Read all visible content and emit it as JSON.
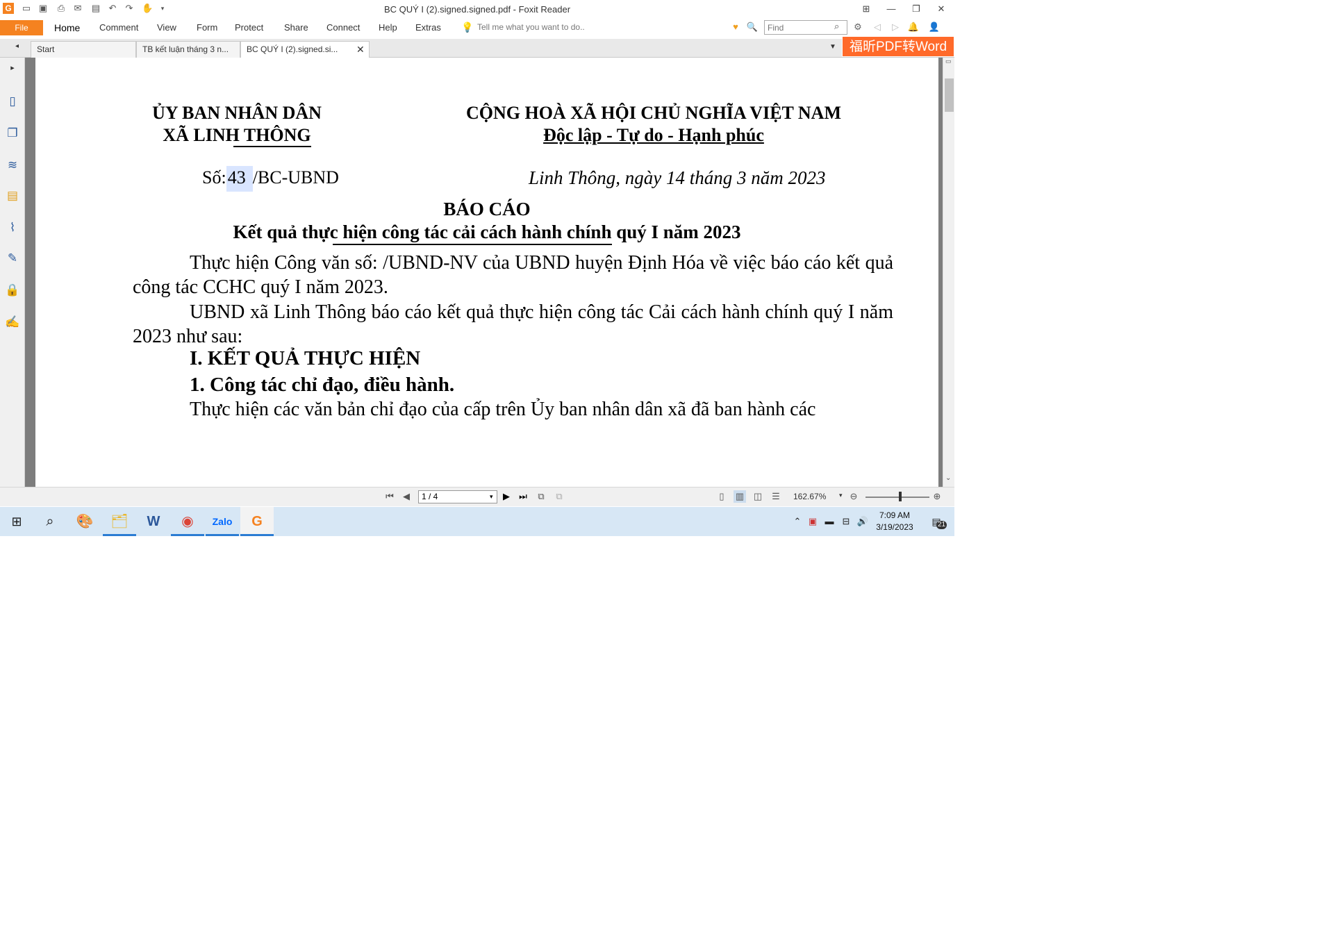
{
  "window": {
    "title": "BC QUÝ I (2).signed.signed.pdf - Foxit Reader"
  },
  "ribbon": {
    "file_label": "File",
    "menus": [
      "Home",
      "Comment",
      "View",
      "Form",
      "Protect",
      "Share",
      "Connect",
      "Help",
      "Extras"
    ],
    "tellme": "Tell me what you want to do..",
    "find_placeholder": "Find"
  },
  "tabs": [
    {
      "label": "Start"
    },
    {
      "label": "TB kết luận tháng 3 n..."
    },
    {
      "label": "BC QUÝ I (2).signed.si..."
    }
  ],
  "promo": "福昕PDF转Word",
  "document": {
    "org_line1": "ỦY BAN NHÂN DÂN",
    "org_line2": "XÃ LINH THÔNG",
    "nation_line1": "CỘNG HOÀ XÃ HỘI CHỦ NGHĨA VIỆT NAM",
    "nation_line2": "Độc lập - Tự do - Hạnh phúc",
    "number_prefix": "Số:",
    "number": "43",
    "number_suffix": "/BC-UBND",
    "place_date": "Linh Thông, ngày 14 tháng 3 năm 2023",
    "title": "BÁO CÁO",
    "subtitle": "Kết quả thực hiện công tác cải cách hành chính quý I năm 2023",
    "para1": "Thực hiện Công văn số:  /UBND-NV của UBND huyện Định Hóa về việc báo cáo kết quả công tác CCHC quý I năm 2023.",
    "para2": "UBND xã Linh Thông báo cáo kết quả thực hiện công tác Cải cách hành chính quý I năm 2023 như sau:",
    "heading1": "I. KẾT QUẢ THỰC HIỆN",
    "heading2": "1. Công tác chỉ đạo, điều hành.",
    "para3": "Thực hiện các văn bản chỉ đạo của cấp trên Ủy ban nhân dân xã đã ban hành các"
  },
  "status": {
    "page": "1 / 4",
    "zoom": "162.67%"
  },
  "taskbar": {
    "apps": [
      "start-button",
      "search-icon",
      "paint-icon",
      "file-explorer-icon",
      "word-icon",
      "chrome-icon",
      "zalo-icon",
      "foxit-reader-icon"
    ],
    "clock_time": "7:09 AM",
    "clock_date": "3/19/2023",
    "notifications": "21"
  },
  "colors": {
    "accent": "#f58220",
    "promo": "#ff6a2a",
    "taskbar": "#d7e7f5",
    "highlight": "#d9e5ff"
  }
}
